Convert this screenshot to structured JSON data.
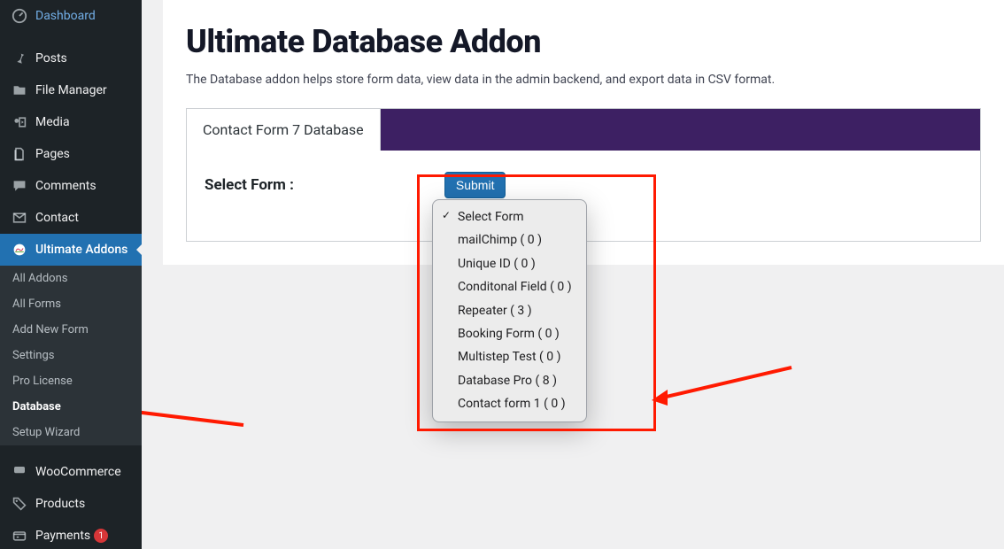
{
  "sidebar": {
    "items": [
      {
        "label": "Dashboard"
      },
      {
        "label": "Posts"
      },
      {
        "label": "File Manager"
      },
      {
        "label": "Media"
      },
      {
        "label": "Pages"
      },
      {
        "label": "Comments"
      },
      {
        "label": "Contact"
      },
      {
        "label": "Ultimate Addons"
      },
      {
        "label": "WooCommerce"
      },
      {
        "label": "Products"
      },
      {
        "label": "Payments",
        "badge": "1"
      }
    ],
    "submenu": [
      {
        "label": "All Addons"
      },
      {
        "label": "All Forms"
      },
      {
        "label": "Add New Form"
      },
      {
        "label": "Settings"
      },
      {
        "label": "Pro License"
      },
      {
        "label": "Database"
      },
      {
        "label": "Setup Wizard"
      }
    ]
  },
  "page": {
    "title": "Ultimate Database Addon",
    "description": "The Database addon helps store form data, view data in the admin backend, and export data in CSV format."
  },
  "tabs": [
    {
      "label": "Contact Form 7 Database"
    }
  ],
  "form_select": {
    "label": "Select Form :",
    "submit_label": "Submit"
  },
  "dropdown": {
    "options": [
      {
        "label": "Select Form",
        "selected": true
      },
      {
        "label": "mailChimp ( 0 )"
      },
      {
        "label": "Unique ID ( 0 )"
      },
      {
        "label": "Conditonal Field ( 0 )"
      },
      {
        "label": "Repeater ( 3 )"
      },
      {
        "label": "Booking Form ( 0 )"
      },
      {
        "label": "Multistep Test ( 0 )"
      },
      {
        "label": "Database Pro ( 8 )"
      },
      {
        "label": "Contact form 1 ( 0 )"
      }
    ]
  },
  "colors": {
    "accent": "#2271b1",
    "tabbar": "#3d2063",
    "highlight": "#ff1a01"
  }
}
